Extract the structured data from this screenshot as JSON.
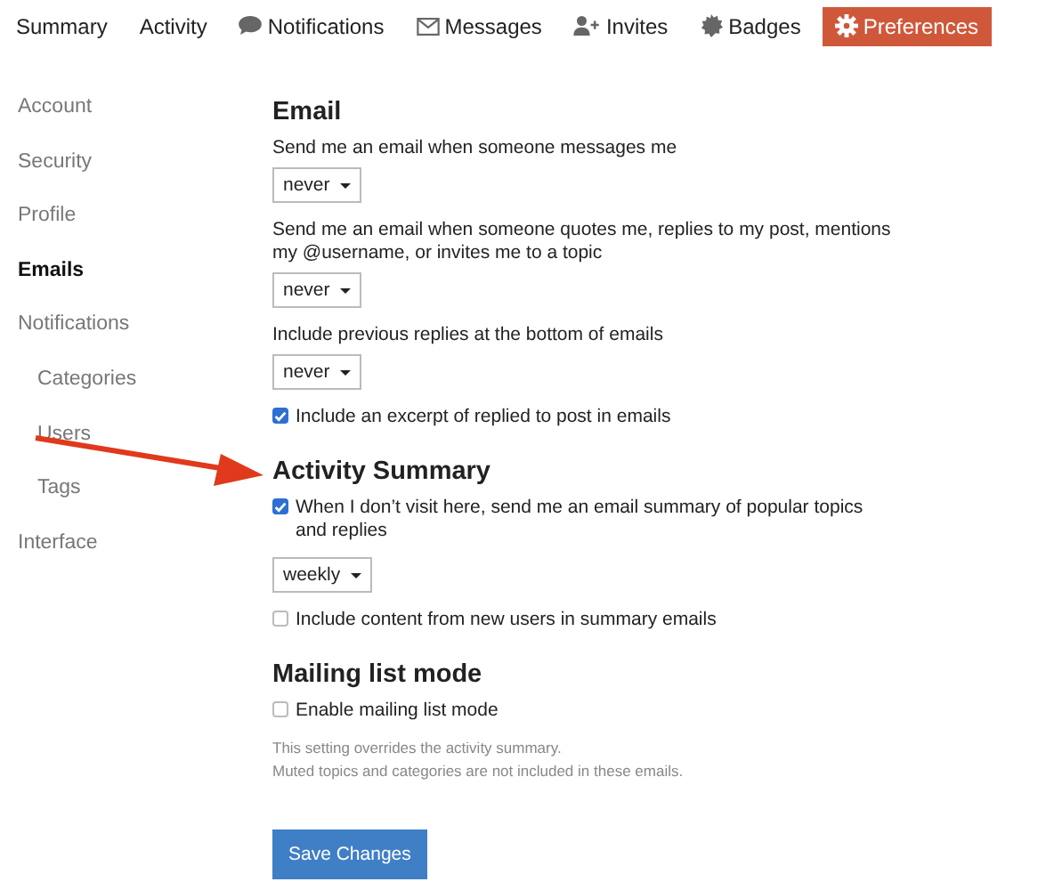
{
  "nav_tabs": [
    {
      "label": "Summary",
      "selected": false
    },
    {
      "label": "Activity",
      "selected": false
    },
    {
      "label": "Notifications",
      "selected": false
    },
    {
      "label": "Messages",
      "selected": false
    },
    {
      "label": "Invites",
      "selected": false
    },
    {
      "label": "Badges",
      "selected": false
    },
    {
      "label": "Preferences",
      "selected": true
    }
  ],
  "sidebar": {
    "items": [
      {
        "label": "Account",
        "selected": false
      },
      {
        "label": "Security",
        "selected": false
      },
      {
        "label": "Profile",
        "selected": false
      },
      {
        "label": "Emails",
        "selected": true
      },
      {
        "label": "Notifications",
        "selected": false,
        "children": [
          {
            "label": "Categories",
            "selected": false
          },
          {
            "label": "Users",
            "selected": false
          },
          {
            "label": "Tags",
            "selected": false
          }
        ]
      },
      {
        "label": "Interface",
        "selected": false
      }
    ]
  },
  "sections": [
    {
      "title": "Email",
      "items": [
        {
          "kind": "select",
          "label": "Send me an email when someone messages me",
          "value": "never"
        },
        {
          "kind": "select",
          "label": "Send me an email when someone quotes me, replies to my post, mentions my @username, or invites me to a topic",
          "value": "never"
        },
        {
          "kind": "select",
          "label": "Include previous replies at the bottom of emails",
          "value": "never"
        },
        {
          "kind": "checkbox",
          "label": "Include an excerpt of replied to post in emails",
          "checked": true
        }
      ]
    },
    {
      "title": "Activity Summary",
      "items": [
        {
          "kind": "checkbox",
          "label": "When I don’t visit here, send me an email summary of popular topics and replies",
          "checked": true
        },
        {
          "kind": "select",
          "value": "weekly"
        },
        {
          "kind": "checkbox",
          "label": "Include content from new users in summary emails",
          "checked": false
        }
      ]
    },
    {
      "title": "Mailing list mode",
      "items": [
        {
          "kind": "checkbox",
          "label": "Enable mailing list mode",
          "checked": false
        },
        {
          "kind": "note",
          "lines": [
            "This setting overrides the activity summary.",
            "Muted topics and categories are not included in these emails."
          ]
        }
      ]
    }
  ],
  "save_button": "Save Changes"
}
